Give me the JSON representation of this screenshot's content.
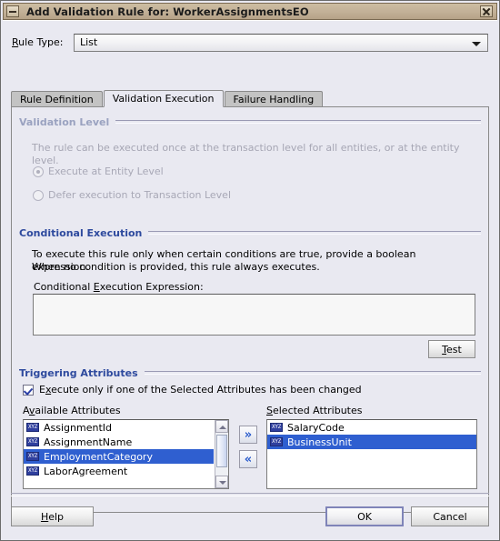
{
  "window": {
    "title": "Add Validation Rule for: WorkerAssignmentsEO",
    "minimize_icon": "minimize-icon",
    "close_icon": "close-icon"
  },
  "rule_type": {
    "label": "Rule Type:",
    "label_mnemonic": "R",
    "value": "List",
    "dropdown_icon": "chevron-down-icon"
  },
  "tabs": [
    {
      "label": "Rule Definition",
      "active": false
    },
    {
      "label": "Validation Execution",
      "active": true
    },
    {
      "label": "Failure Handling",
      "active": false
    }
  ],
  "validation_level": {
    "title": "Validation Level",
    "description": "The rule can be executed once at the transaction level for all entities, or at the entity level.",
    "options": [
      {
        "label": "Execute at Entity Level",
        "selected": true
      },
      {
        "label": "Defer execution to Transaction Level",
        "selected": false
      }
    ],
    "enabled": false
  },
  "conditional_execution": {
    "title": "Conditional Execution",
    "description_line1": "To execute this rule only when certain conditions are true, provide a boolean expression.",
    "description_line2": "When no condition is provided, this rule always executes.",
    "expression_label": "Conditional Execution Expression:",
    "expression_value": "",
    "test_button": "Test"
  },
  "triggering_attributes": {
    "title": "Triggering Attributes",
    "checkbox_label": "Execute only if one of the Selected Attributes has been changed",
    "checkbox_checked": true,
    "available_label": "Available Attributes",
    "selected_label": "Selected Attributes",
    "available_items": [
      {
        "label": "AssignmentId",
        "icon": "xyz-attribute-icon",
        "selected": false
      },
      {
        "label": "AssignmentName",
        "icon": "xyz-attribute-icon",
        "selected": false
      },
      {
        "label": "EmploymentCategory",
        "icon": "xyz-attribute-icon",
        "selected": true
      },
      {
        "label": "LaborAgreement",
        "icon": "xyz-attribute-icon",
        "selected": false
      }
    ],
    "selected_items": [
      {
        "label": "SalaryCode",
        "icon": "xyz-attribute-icon",
        "selected": false
      },
      {
        "label": "BusinessUnit",
        "icon": "xyz-attribute-icon",
        "selected": true
      }
    ],
    "add_button_icon": "double-chevron-right-icon",
    "remove_button_icon": "double-chevron-left-icon"
  },
  "footer": {
    "help": "Help",
    "ok": "OK",
    "cancel": "Cancel"
  },
  "colors": {
    "titlebar": "#c2b097",
    "dialog_background": "#e9e9f1",
    "section_header": "#2e4a9e",
    "selection_blue": "#2f5fd0",
    "disabled_text": "#a8a8b6",
    "default_button_border": "#7f84b8"
  }
}
